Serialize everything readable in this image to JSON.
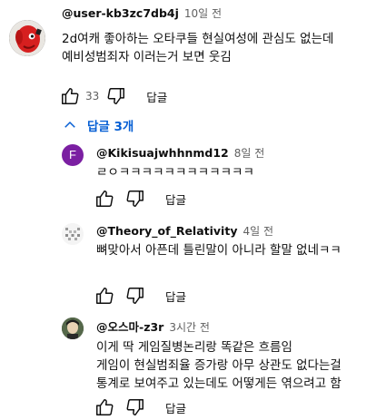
{
  "top_comment": {
    "author": "@user-kb3zc7db4j",
    "time": "10일 전",
    "lines": [
      "2d여캐 좋아하는 오타쿠들 현실여성에 관심도 없는데",
      "예비성범죄자 이러는거 보면 웃김"
    ],
    "like_count": "33",
    "reply_label": "답글",
    "avatar_icon": "red-character-avatar"
  },
  "replies_toggle": {
    "label": "답글 3개",
    "icon": "chevron-up-icon",
    "color": "#065fd4"
  },
  "replies": [
    {
      "author": "@Kikisuajwhhnmd12",
      "time": "8일 전",
      "lines": [
        "ㄹㅇㅋㅋㅋㅋㅋㅋㅋㅋㅋㅋㅋㅋ"
      ],
      "reply_label": "답글",
      "avatar_letter": "F",
      "avatar_color": "#7b1fa2"
    },
    {
      "author": "@Theory_of_Relativity",
      "time": "4일 전",
      "lines": [
        "뼈맞아서 아픈데 틀린말이 아니라 할말 없네ㅋㅋ"
      ],
      "reply_label": "답글",
      "avatar_icon": "identicon-avatar"
    },
    {
      "author": "@오스마-z3r",
      "time": "3시간 전",
      "lines": [
        "이게 딱 게임질병논리랑 똑같은 흐름임",
        "게임이 현실범죄율 증가랑 아무 상관도 없다는걸",
        "통계로 보여주고 있는데도 어떻게든 엮으려고 함"
      ],
      "reply_label": "답글",
      "avatar_icon": "character-avatar"
    }
  ]
}
